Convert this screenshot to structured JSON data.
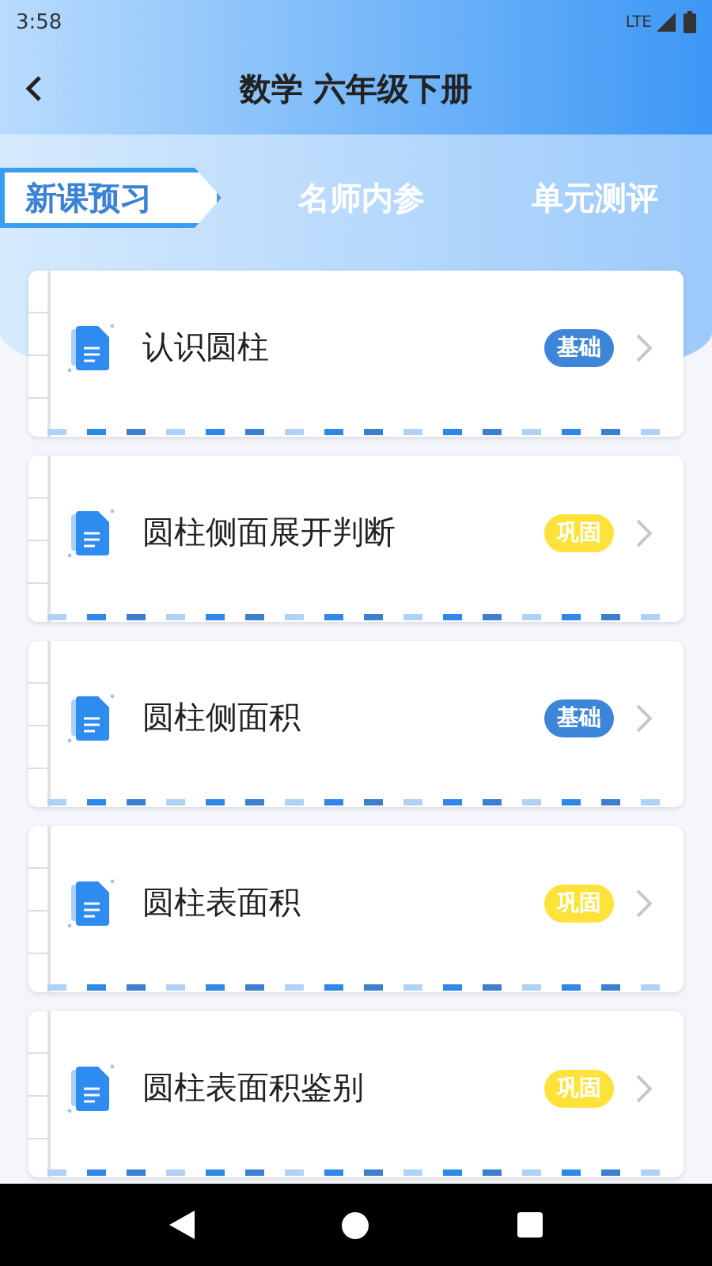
{
  "status_bar": {
    "time": "3:58",
    "network": "LTE"
  },
  "header": {
    "title": "数学 六年级下册"
  },
  "tabs": [
    {
      "label": "新课预习",
      "selected": true
    },
    {
      "label": "名师内参",
      "selected": false
    },
    {
      "label": "单元测评",
      "selected": false
    }
  ],
  "lessons": [
    {
      "title": "认识圆柱",
      "badge": "基础",
      "kind": "basic"
    },
    {
      "title": "圆柱侧面展开判断",
      "badge": "巩固",
      "kind": "review"
    },
    {
      "title": "圆柱侧面积",
      "badge": "基础",
      "kind": "basic"
    },
    {
      "title": "圆柱表面积",
      "badge": "巩固",
      "kind": "review"
    },
    {
      "title": "圆柱表面积鉴别",
      "badge": "巩固",
      "kind": "review"
    }
  ]
}
